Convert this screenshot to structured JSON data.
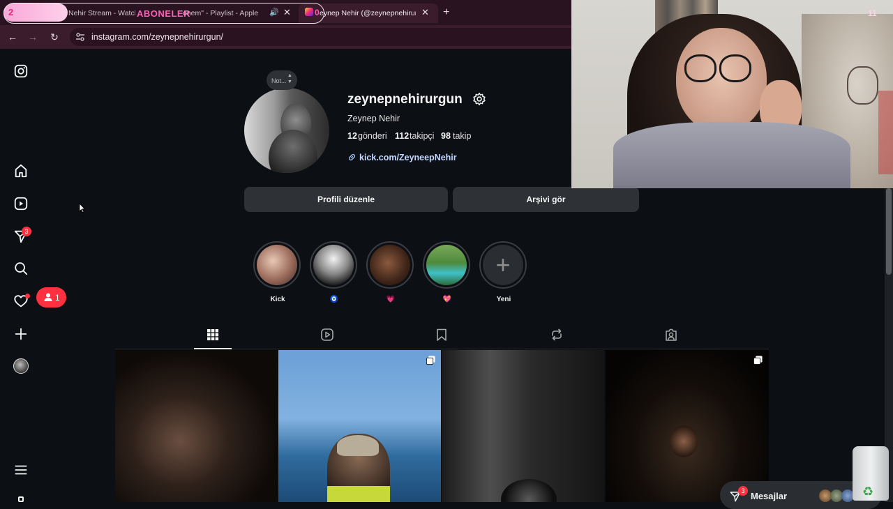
{
  "browser": {
    "tabs": [
      {
        "title": "Nehir Stream - Watch"
      },
      {
        "title": "onem\" - Playlist - Apple"
      },
      {
        "title": "eynep Nehir (@zeynepnehirur"
      }
    ],
    "overlay_text": "ABONELER",
    "overlay_count_left": "2",
    "overlay_count_mid": "0",
    "url": "instagram.com/zeynepnehirurgun/",
    "new_tab_glyph": "+",
    "close_glyph": "✕"
  },
  "sidebar": {
    "items": [
      {
        "icon": "instagram-icon"
      },
      {
        "icon": "home-icon"
      },
      {
        "icon": "reels-icon"
      },
      {
        "icon": "direct-icon",
        "badge": "3"
      },
      {
        "icon": "search-icon"
      },
      {
        "icon": "heart-icon"
      },
      {
        "icon": "create-icon"
      },
      {
        "icon": "avatar"
      },
      {
        "icon": "menu-icon"
      }
    ],
    "notification_pill": {
      "count": "1"
    }
  },
  "profile": {
    "note_label": "Not...",
    "username": "zeynepnehirurgun",
    "display_name": "Zeynep Nehir",
    "stats": {
      "posts_count": "12",
      "posts_label": "gönderi",
      "followers_count": "112",
      "followers_label": "takipçi",
      "following_count": "98",
      "following_label": "takip"
    },
    "link": "kick.com/ZeyneepNehir",
    "edit_button": "Profili düzenle",
    "archive_button": "Arşivi gör"
  },
  "highlights": [
    {
      "label": "Kick"
    },
    {
      "label": "🧿"
    },
    {
      "label": "💗"
    },
    {
      "label": "💖"
    },
    {
      "label": "Yeni"
    }
  ],
  "tabs": [
    {
      "icon": "grid-icon",
      "active": true
    },
    {
      "icon": "reels-tab-icon"
    },
    {
      "icon": "saved-icon"
    },
    {
      "icon": "reposts-icon"
    },
    {
      "icon": "tagged-icon"
    }
  ],
  "webcam": {
    "counter": "11"
  },
  "messages": {
    "label": "Mesajlar",
    "badge": "3"
  },
  "colors": {
    "accent": "#e0245e",
    "link": "#e0f1ff",
    "background": "#0c0f14"
  }
}
